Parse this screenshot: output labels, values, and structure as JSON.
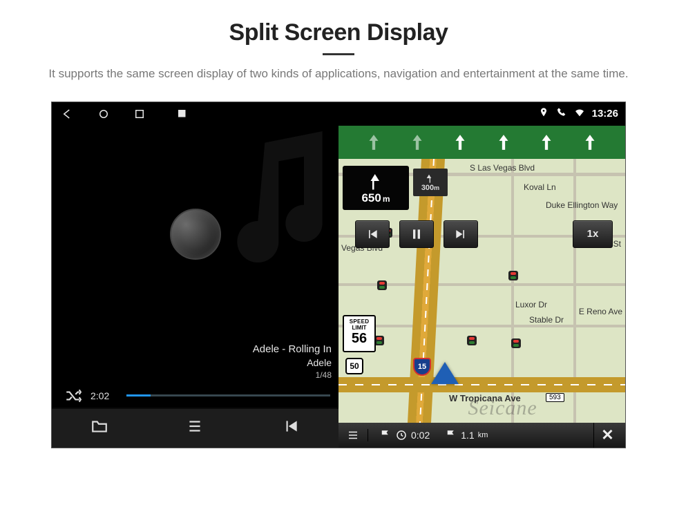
{
  "page": {
    "title": "Split Screen Display",
    "subtitle": "It supports the same screen display of two kinds of applications, navigation and entertainment at the same time."
  },
  "statusbar": {
    "time": "13:26"
  },
  "player": {
    "track_title": "Adele - Rolling In",
    "track_artist": "Adele",
    "track_index": "1/48",
    "elapsed": "2:02"
  },
  "nav": {
    "turn_distance": "650",
    "turn_unit": "m",
    "next_distance": "300",
    "next_unit": "m",
    "speed_limit_label1": "SPEED",
    "speed_limit_label2": "LIMIT",
    "speed_limit_value": "56",
    "route_shield": "50",
    "interstate": "15",
    "playback_speed": "1x",
    "eta_time": "0:02",
    "remaining_distance": "1.1",
    "remaining_unit": "km",
    "street_main": "W Tropicana Ave",
    "exit_tag": "593",
    "labels": {
      "s_las_vegas": "S Las Vegas Blvd",
      "koval": "Koval Ln",
      "vegas_blvd": "Vegas Blvd",
      "duke": "Duke Ellington Way",
      "luxor": "Luxor Dr",
      "reno_split": "E Reno Ave",
      "stable": "Stable Dr",
      "giles": "iles St"
    }
  },
  "watermark": "Seicane"
}
